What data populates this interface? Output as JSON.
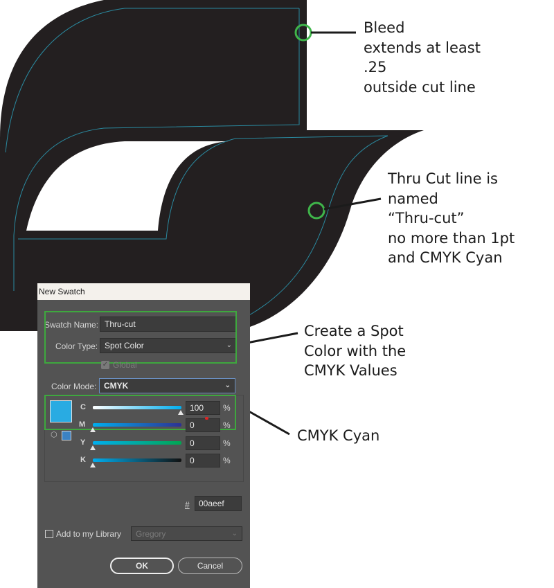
{
  "colors": {
    "artwork_fill": "#231f20",
    "cut_line": "#1f8fa8",
    "callout_marker": "#3fb54a",
    "highlight": "#3ea83e",
    "swatch": "#29abe2",
    "dialog_bg": "#535353"
  },
  "callouts": {
    "bleed": "Bleed\nextends at least\n.25\noutside cut line",
    "thru_cut": "Thru Cut line is\nnamed\n“Thru-cut”\nno more than 1pt\nand CMYK Cyan",
    "spot_color": "Create a Spot\nColor with the\nCMYK Values",
    "cmyk_cyan": "CMYK Cyan"
  },
  "dialog": {
    "title": "New Swatch",
    "swatch_name_label": "Swatch Name:",
    "swatch_name_value": "Thru-cut",
    "color_type_label": "Color Type:",
    "color_type_value": "Spot Color",
    "global_label": "Global",
    "color_mode_label": "Color Mode:",
    "color_mode_value": "CMYK",
    "channels": [
      {
        "label": "C",
        "value": "100",
        "level": 1.0
      },
      {
        "label": "M",
        "value": "0",
        "level": 0.0
      },
      {
        "label": "Y",
        "value": "0",
        "level": 0.0
      },
      {
        "label": "K",
        "value": "0",
        "level": 0.0
      }
    ],
    "percent": "%",
    "hex_label": "#",
    "hex_value": "00aeef",
    "add_library_label": "Add to my Library",
    "library_value": "Gregory",
    "ok_label": "OK",
    "cancel_label": "Cancel"
  },
  "icons": [
    "circle-marker-icon",
    "chevron-down-icon",
    "checkbox-icon",
    "cube-icon",
    "slider-thumb-icon"
  ]
}
